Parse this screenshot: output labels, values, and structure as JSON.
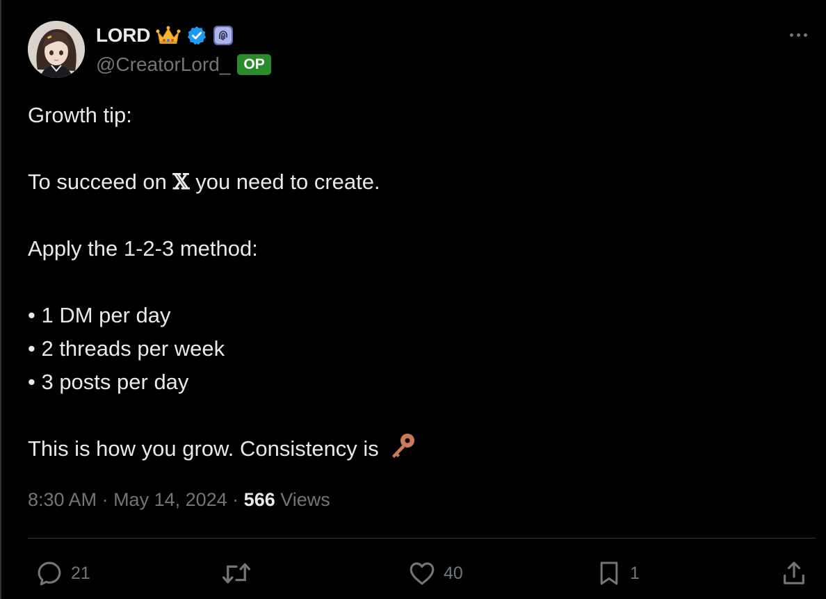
{
  "author": {
    "display_name": "LORD",
    "handle": "@CreatorLord_",
    "op_badge": "OP",
    "verified_color": "#1d9bf0",
    "icons": [
      "crown-emoji",
      "verified-badge-icon",
      "fingerprint-badge-icon"
    ]
  },
  "tweet": {
    "line1": "Growth tip:",
    "line2_before": "To succeed on ",
    "line2_x": "𝕏",
    "line2_after": " you need to create.",
    "line3": "Apply the 1-2-3 method:",
    "bullet1": "• 1 DM per day",
    "bullet2": "• 2 threads per week",
    "bullet3": "• 3 posts per day",
    "closing": "This is how you grow. Consistency is ",
    "closing_icon": "key-emoji"
  },
  "meta": {
    "time": "8:30 AM",
    "sep1": " · ",
    "date": "May 14, 2024",
    "sep2": " · ",
    "views_count": "566",
    "views_label": " Views"
  },
  "actions": {
    "replies": "21",
    "retweets": "",
    "likes": "40",
    "bookmarks": "1"
  },
  "colors": {
    "background": "#000000",
    "text": "#e7e9ea",
    "muted": "#71767b",
    "op_green": "#2b8a2b"
  }
}
